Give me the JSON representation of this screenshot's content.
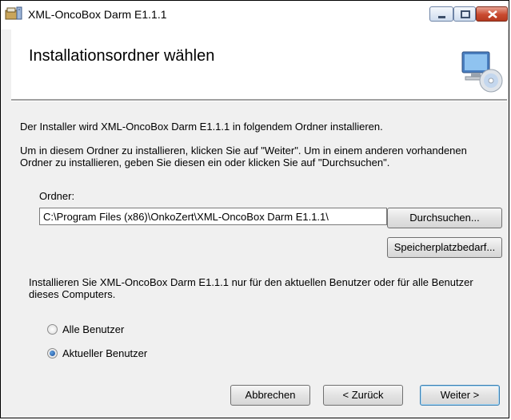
{
  "window": {
    "title": "XML-OncoBox Darm E1.1.1",
    "app_icon": "installer-box-icon",
    "controls": [
      "minimize-icon",
      "maximize-icon",
      "close-icon"
    ]
  },
  "header": {
    "title": "Installationsordner wählen",
    "icon": "computer-cd-icon"
  },
  "main": {
    "intro": "Der Installer wird XML-OncoBox Darm E1.1.1 in folgendem Ordner installieren.",
    "instructions_line1": "Um in diesem Ordner zu installieren, klicken Sie auf \"Weiter\". Um in einem anderen vorhandenen",
    "instructions_line2": "Ordner zu installieren, geben Sie diesen ein oder klicken Sie auf \"Durchsuchen\".",
    "folder_label": "Ordner:",
    "folder_value": "C:\\Program Files (x86)\\OnkoZert\\XML-OncoBox Darm E1.1.1\\",
    "browse_button": "Durchsuchen...",
    "disk_cost_button": "Speicherplatzbedarf...",
    "users_text_line1": "Installieren Sie XML-OncoBox Darm E1.1.1 nur für den aktuellen Benutzer oder für alle Benutzer",
    "users_text_line2": "dieses Computers.",
    "radio_all": "Alle Benutzer",
    "radio_current": "Aktueller Benutzer",
    "selected_option": "Aktueller Benutzer"
  },
  "footer": {
    "cancel_button": "Abbrechen",
    "back_button": "< Zurück",
    "next_button": "Weiter >"
  }
}
